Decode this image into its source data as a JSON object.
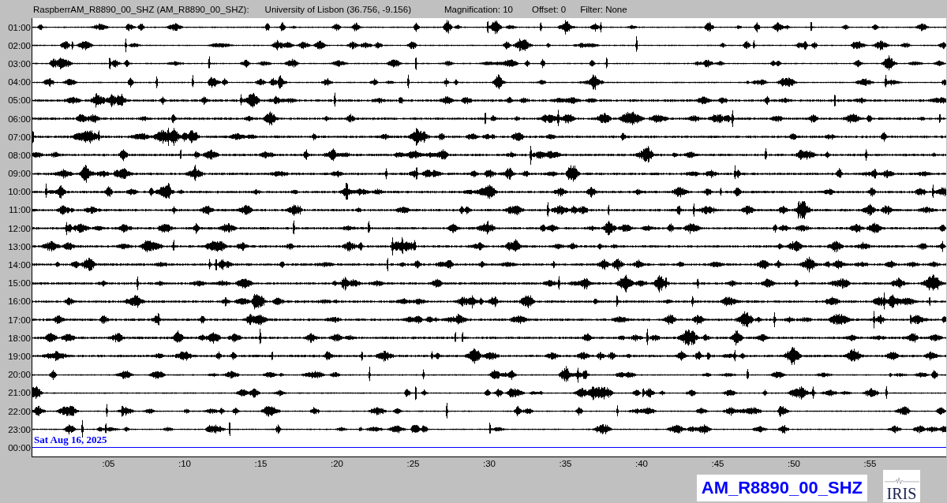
{
  "header": {
    "station": "RaspberrAM_R8890_00_SHZ (AM_R8890_00_SHZ):",
    "location": "University of Lisbon (36.756, -9.156)",
    "magnification": "Magnification: 10",
    "offset": "Offset: 0",
    "filter": "Filter: None"
  },
  "rows": [
    {
      "label": "01:00",
      "kind": "trace"
    },
    {
      "label": "02:00",
      "kind": "trace"
    },
    {
      "label": "03:00",
      "kind": "trace"
    },
    {
      "label": "04:00",
      "kind": "trace"
    },
    {
      "label": "05:00",
      "kind": "trace"
    },
    {
      "label": "06:00",
      "kind": "trace"
    },
    {
      "label": "07:00",
      "kind": "trace"
    },
    {
      "label": "08:00",
      "kind": "trace"
    },
    {
      "label": "09:00",
      "kind": "trace"
    },
    {
      "label": "10:00",
      "kind": "trace"
    },
    {
      "label": "11:00",
      "kind": "trace"
    },
    {
      "label": "12:00",
      "kind": "trace"
    },
    {
      "label": "13:00",
      "kind": "trace"
    },
    {
      "label": "14:00",
      "kind": "trace"
    },
    {
      "label": "15:00",
      "kind": "trace"
    },
    {
      "label": "16:00",
      "kind": "trace"
    },
    {
      "label": "17:00",
      "kind": "trace"
    },
    {
      "label": "18:00",
      "kind": "trace"
    },
    {
      "label": "19:00",
      "kind": "trace"
    },
    {
      "label": "20:00",
      "kind": "trace"
    },
    {
      "label": "21:00",
      "kind": "trace"
    },
    {
      "label": "22:00",
      "kind": "trace"
    },
    {
      "label": "23:00",
      "kind": "trace"
    },
    {
      "label": "00:00",
      "kind": "current",
      "date": "Sat Aug 16, 2025"
    }
  ],
  "x_ticks": [
    ":05",
    ":10",
    ":15",
    ":20",
    ":25",
    ":30",
    ":35",
    ":40",
    ":45",
    ":50",
    ":55"
  ],
  "station_badge": "AM_R8890_00_SHZ",
  "logo": "IRIS"
}
